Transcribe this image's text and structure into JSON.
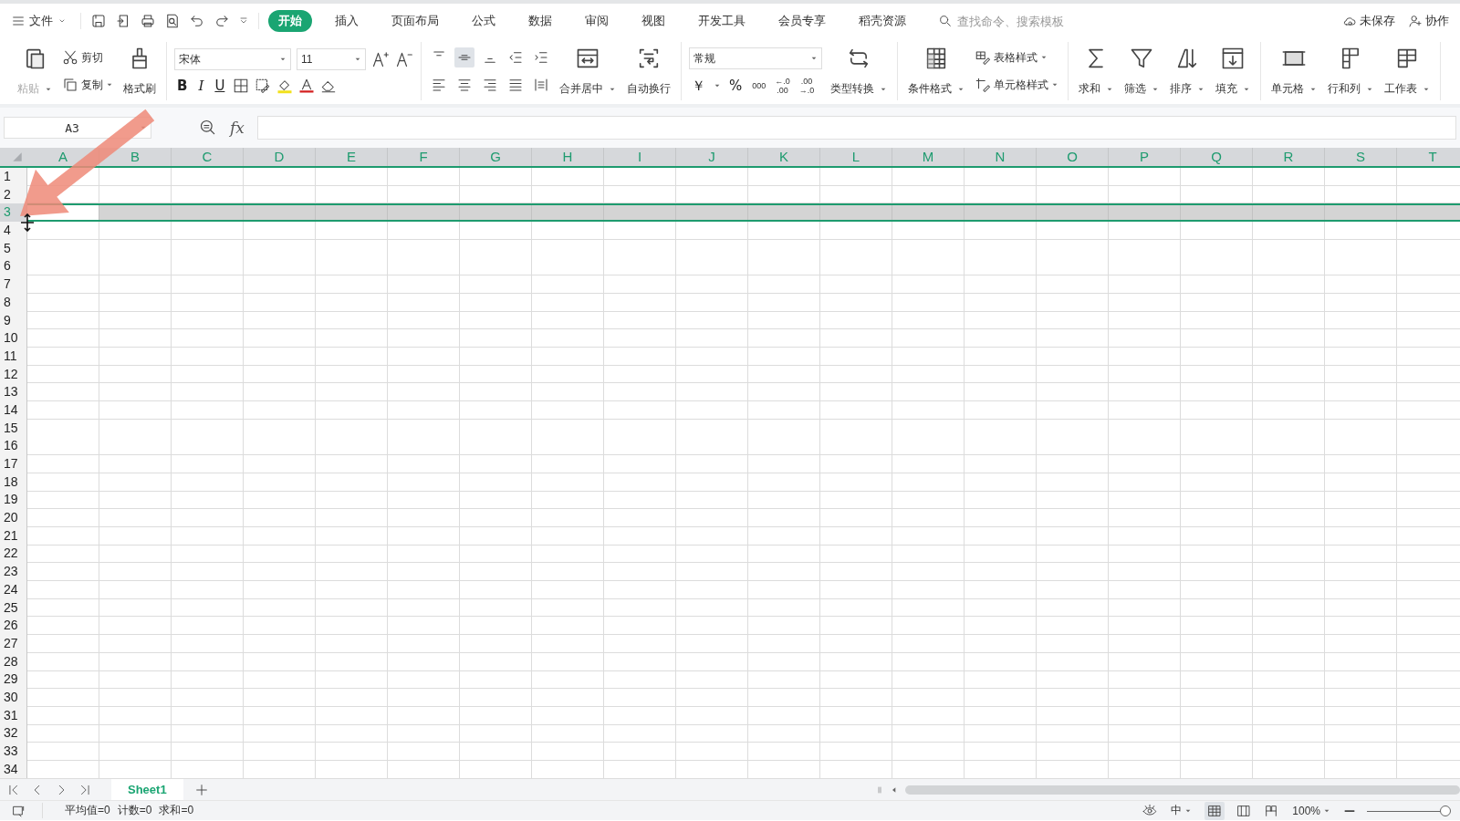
{
  "menu": {
    "label": "文件"
  },
  "tabs": [
    {
      "label": "开始",
      "selected": true
    },
    {
      "label": "插入",
      "selected": false
    },
    {
      "label": "页面布局",
      "selected": false
    },
    {
      "label": "公式",
      "selected": false
    },
    {
      "label": "数据",
      "selected": false
    },
    {
      "label": "审阅",
      "selected": false
    },
    {
      "label": "视图",
      "selected": false
    },
    {
      "label": "开发工具",
      "selected": false
    },
    {
      "label": "会员专享",
      "selected": false
    },
    {
      "label": "稻壳资源",
      "selected": false
    }
  ],
  "search": {
    "placeholder": "查找命令、搜索模板"
  },
  "top_actions": [
    {
      "label": "未保存"
    },
    {
      "label": "协作"
    }
  ],
  "clipboard": {
    "paste": {
      "label": "粘贴",
      "disabled": true
    },
    "cut": "剪切",
    "copy": "复制",
    "painter": "格式刷"
  },
  "font": {
    "name": "宋体",
    "size": "11",
    "styles": [
      "B",
      "I",
      "U"
    ]
  },
  "alignment": {
    "merge": "合并居中",
    "wrap": "自动换行"
  },
  "number": {
    "format": "常规",
    "currency": "￥",
    "percent": "%",
    "thousands": "000",
    "decimals": [
      [
        "←.0",
        ".00"
      ],
      [
        ".00",
        "→.0"
      ]
    ],
    "convert": "类型转换"
  },
  "styles": {
    "conditional": "条件格式",
    "table": "表格样式",
    "cell": "单元格样式"
  },
  "editing": [
    {
      "label": "求和"
    },
    {
      "label": "筛选"
    },
    {
      "label": "排序"
    },
    {
      "label": "填充"
    }
  ],
  "cells": [
    {
      "label": "单元格"
    },
    {
      "label": "行和列"
    },
    {
      "label": "工作表"
    }
  ],
  "formula_bar": {
    "name_box": "A3",
    "fx": "fx"
  },
  "columns": [
    {
      "label": "A",
      "selected": true
    },
    {
      "label": "B",
      "selected": true
    },
    {
      "label": "C",
      "selected": true
    },
    {
      "label": "D",
      "selected": true
    },
    {
      "label": "E",
      "selected": true
    },
    {
      "label": "F",
      "selected": true
    },
    {
      "label": "G",
      "selected": true
    },
    {
      "label": "H",
      "selected": true
    },
    {
      "label": "I",
      "selected": true
    },
    {
      "label": "J",
      "selected": true
    },
    {
      "label": "K",
      "selected": true
    },
    {
      "label": "L",
      "selected": true
    },
    {
      "label": "M",
      "selected": true
    },
    {
      "label": "N",
      "selected": true
    },
    {
      "label": "O",
      "selected": true
    },
    {
      "label": "P",
      "selected": true
    },
    {
      "label": "Q",
      "selected": true
    },
    {
      "label": "R",
      "selected": true
    },
    {
      "label": "S",
      "selected": true
    },
    {
      "label": "T",
      "selected": true
    }
  ],
  "rows": [
    {
      "label": "1",
      "selected": false
    },
    {
      "label": "2",
      "selected": false
    },
    {
      "label": "3",
      "selected": true
    },
    {
      "label": "4",
      "selected": false
    },
    {
      "label": "5",
      "selected": false
    },
    {
      "label": "6",
      "selected": false
    },
    {
      "label": "7",
      "selected": false
    },
    {
      "label": "8",
      "selected": false
    },
    {
      "label": "9",
      "selected": false
    },
    {
      "label": "10",
      "selected": false
    },
    {
      "label": "11",
      "selected": false
    },
    {
      "label": "12",
      "selected": false
    },
    {
      "label": "13",
      "selected": false
    },
    {
      "label": "14",
      "selected": false
    },
    {
      "label": "15",
      "selected": false
    },
    {
      "label": "16",
      "selected": false
    },
    {
      "label": "17",
      "selected": false
    },
    {
      "label": "18",
      "selected": false
    },
    {
      "label": "19",
      "selected": false
    },
    {
      "label": "20",
      "selected": false
    },
    {
      "label": "21",
      "selected": false
    },
    {
      "label": "22",
      "selected": false
    },
    {
      "label": "23",
      "selected": false
    },
    {
      "label": "24",
      "selected": false
    },
    {
      "label": "25",
      "selected": false
    },
    {
      "label": "26",
      "selected": false
    },
    {
      "label": "27",
      "selected": false
    },
    {
      "label": "28",
      "selected": false
    },
    {
      "label": "29",
      "selected": false
    },
    {
      "label": "30",
      "selected": false
    },
    {
      "label": "31",
      "selected": false
    },
    {
      "label": "32",
      "selected": false
    },
    {
      "label": "33",
      "selected": false
    },
    {
      "label": "34",
      "selected": false
    }
  ],
  "sheets": [
    {
      "label": "Sheet1",
      "selected": true
    }
  ],
  "status_bar": {
    "summary": [
      "平均值=0",
      "计数=0",
      "求和=0"
    ],
    "input_mode": "中",
    "zoom": "100%",
    "zoom_slider": {
      "level": 0.95
    }
  }
}
